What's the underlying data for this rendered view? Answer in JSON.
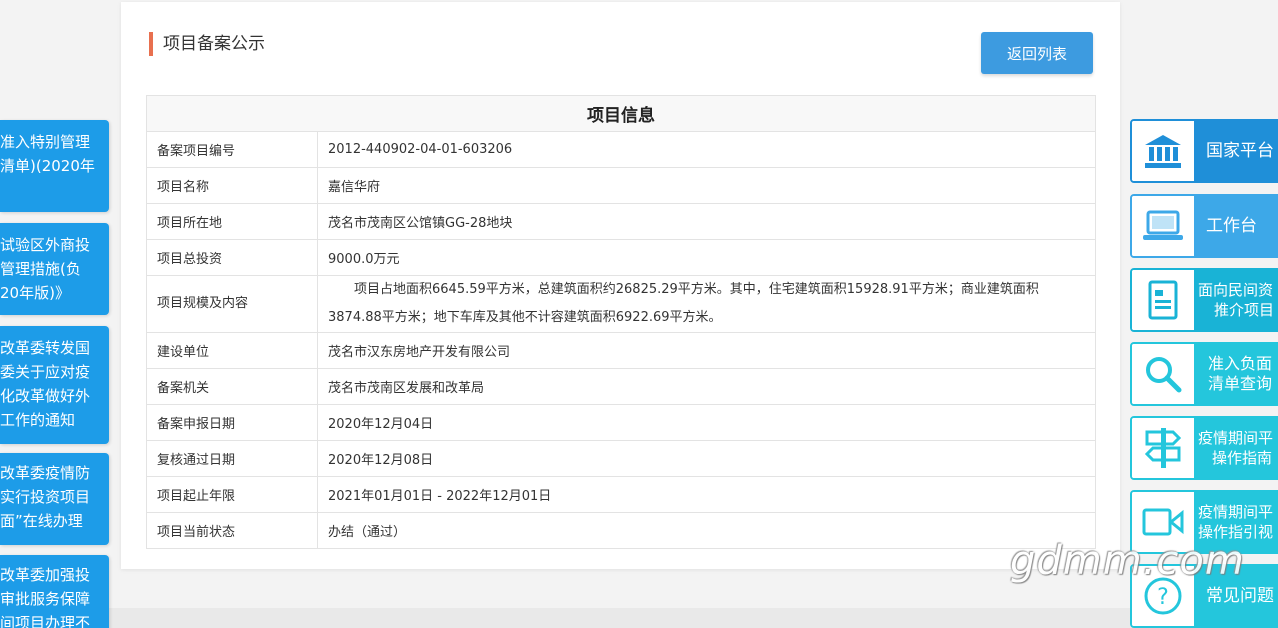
{
  "panel": {
    "title": "项目备案公示",
    "back_button": "返回列表"
  },
  "table": {
    "header": "项目信息",
    "rows": [
      {
        "label": "备案项目编号",
        "value": "2012-440902-04-01-603206"
      },
      {
        "label": "项目名称",
        "value": "嘉信华府"
      },
      {
        "label": "项目所在地",
        "value": "茂名市茂南区公馆镇GG-28地块"
      },
      {
        "label": "项目总投资",
        "value": "9000.0万元"
      },
      {
        "label": "项目规模及内容",
        "value_line1": "项目占地面积6645.59平方米，总建筑面积约26825.29平方米。其中，住宅建筑面积15928.91平方米；商业建筑面积",
        "value_line2": "3874.88平方米；地下车库及其他不计容建筑面积6922.69平方米。"
      },
      {
        "label": "建设单位",
        "value": "茂名市汉东房地产开发有限公司"
      },
      {
        "label": "备案机关",
        "value": "茂名市茂南区发展和改革局"
      },
      {
        "label": "备案申报日期",
        "value": "2020年12月04日"
      },
      {
        "label": "复核通过日期",
        "value": "2020年12月08日"
      },
      {
        "label": "项目起止年限",
        "value": "2021年01月01日 - 2022年12月01日"
      },
      {
        "label": "项目当前状态",
        "value": "办结（通过）"
      }
    ]
  },
  "left_notices": [
    {
      "lines": [
        "准入特别管理",
        "清单)(2020年"
      ]
    },
    {
      "lines": [
        "试验区外商投",
        "管理措施(负",
        "20年版)》"
      ]
    },
    {
      "lines": [
        "改革委转发国",
        "委关于应对疫",
        "化改革做好外",
        "工作的通知"
      ]
    },
    {
      "lines": [
        "改革委疫情防",
        "实行投资项目",
        "面”在线办理"
      ]
    },
    {
      "lines": [
        "改革委加强投",
        "审批服务保障",
        "间项目办理不"
      ]
    }
  ],
  "right_nav": [
    {
      "label": "国家平台",
      "icon": "building-icon"
    },
    {
      "label": "工作台",
      "icon": "laptop-icon"
    },
    {
      "lines": [
        "面向民间资",
        "推介项目"
      ],
      "icon": "document-icon"
    },
    {
      "lines": [
        "准入负面",
        "清单查询"
      ],
      "icon": "search-icon"
    },
    {
      "lines": [
        "疫情期间平",
        "操作指南"
      ],
      "icon": "signpost-icon"
    },
    {
      "lines": [
        "疫情期间平",
        "操作指引视"
      ],
      "icon": "video-camera-icon"
    },
    {
      "label": "常见问题",
      "icon": "question-icon"
    }
  ],
  "watermark": "gdmm.com",
  "colors": {
    "accent_bar": "#e8704f",
    "button_blue": "#3d9be0",
    "notice_blue": "#1d9ce8",
    "nav_cyan": "#19b3d6",
    "nav_blue": "#1f8fd8"
  }
}
